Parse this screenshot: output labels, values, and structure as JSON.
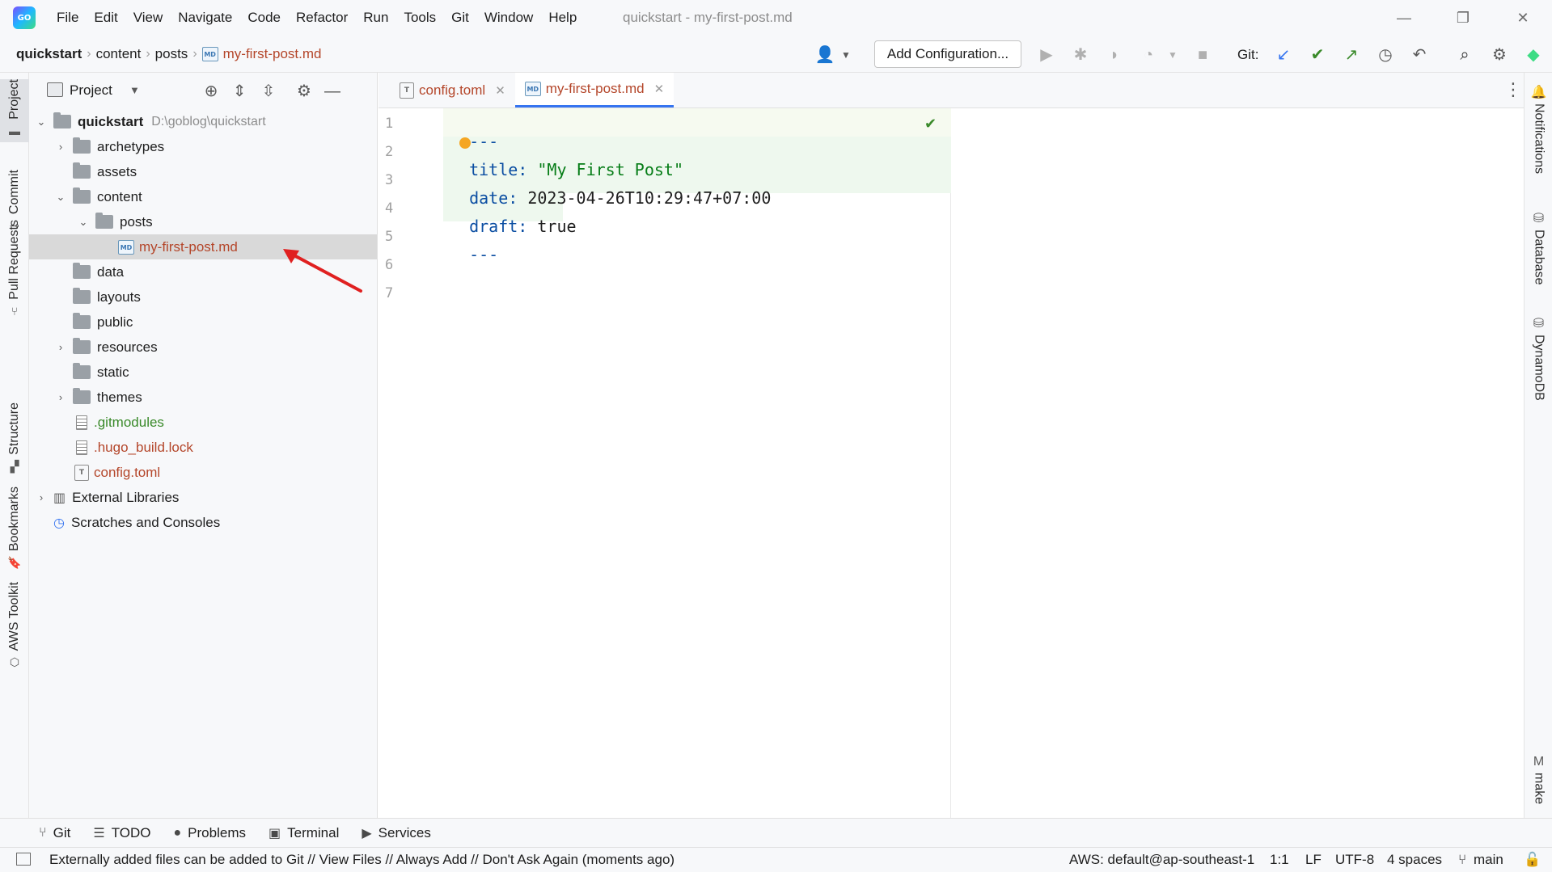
{
  "menubar": {
    "logo": "GO",
    "items": [
      "File",
      "Edit",
      "View",
      "Navigate",
      "Code",
      "Refactor",
      "Run",
      "Tools",
      "Git",
      "Window",
      "Help"
    ],
    "title": "quickstart - my-first-post.md"
  },
  "navbar": {
    "breadcrumbs": [
      "quickstart",
      "content",
      "posts",
      "my-first-post.md"
    ],
    "add_config": "Add Configuration...",
    "git_label": "Git:"
  },
  "left_tabs": [
    "Project",
    "Commit",
    "Pull Requests",
    "Structure",
    "Bookmarks",
    "AWS Toolkit"
  ],
  "right_tabs": [
    "Notifications",
    "Database",
    "DynamoDB",
    "make"
  ],
  "project": {
    "header": "Project",
    "tree": [
      {
        "label": "quickstart",
        "path": "D:\\goblog\\quickstart"
      },
      {
        "label": "archetypes"
      },
      {
        "label": "assets"
      },
      {
        "label": "content"
      },
      {
        "label": "posts"
      },
      {
        "label": "my-first-post.md"
      },
      {
        "label": "data"
      },
      {
        "label": "layouts"
      },
      {
        "label": "public"
      },
      {
        "label": "resources"
      },
      {
        "label": "static"
      },
      {
        "label": "themes"
      },
      {
        "label": ".gitmodules"
      },
      {
        "label": ".hugo_build.lock"
      },
      {
        "label": "config.toml"
      },
      {
        "label": "External Libraries"
      },
      {
        "label": "Scratches and Consoles"
      }
    ]
  },
  "editor": {
    "tabs": [
      {
        "label": "config.toml",
        "badge": "T"
      },
      {
        "label": "my-first-post.md",
        "badge": "MD"
      }
    ],
    "line_numbers": [
      "1",
      "2",
      "3",
      "4",
      "5",
      "6",
      "7"
    ],
    "lines": [
      {
        "key": "---",
        "value": ""
      },
      {
        "key": "title:",
        "value": " \"My First Post\""
      },
      {
        "key": "date:",
        "value": " 2023-04-26T10:29:47+07:00"
      },
      {
        "key": "draft:",
        "value": " true"
      },
      {
        "key": "---",
        "value": ""
      }
    ]
  },
  "bottombar": [
    "Git",
    "TODO",
    "Problems",
    "Terminal",
    "Services"
  ],
  "statusbar": {
    "message": "Externally added files can be added to Git // View Files // Always Add // Don't Ask Again (moments ago)",
    "aws": "AWS: default@ap-southeast-1",
    "position": "1:1",
    "line_sep": "LF",
    "encoding": "UTF-8",
    "indent": "4 spaces",
    "branch": "main"
  },
  "colors": {
    "accent": "#3574f0",
    "selection": "#d9d9d9",
    "git_added": "#3a8a2a",
    "git_modified": "#b4462a",
    "annotation_arrow": "#e02020"
  }
}
